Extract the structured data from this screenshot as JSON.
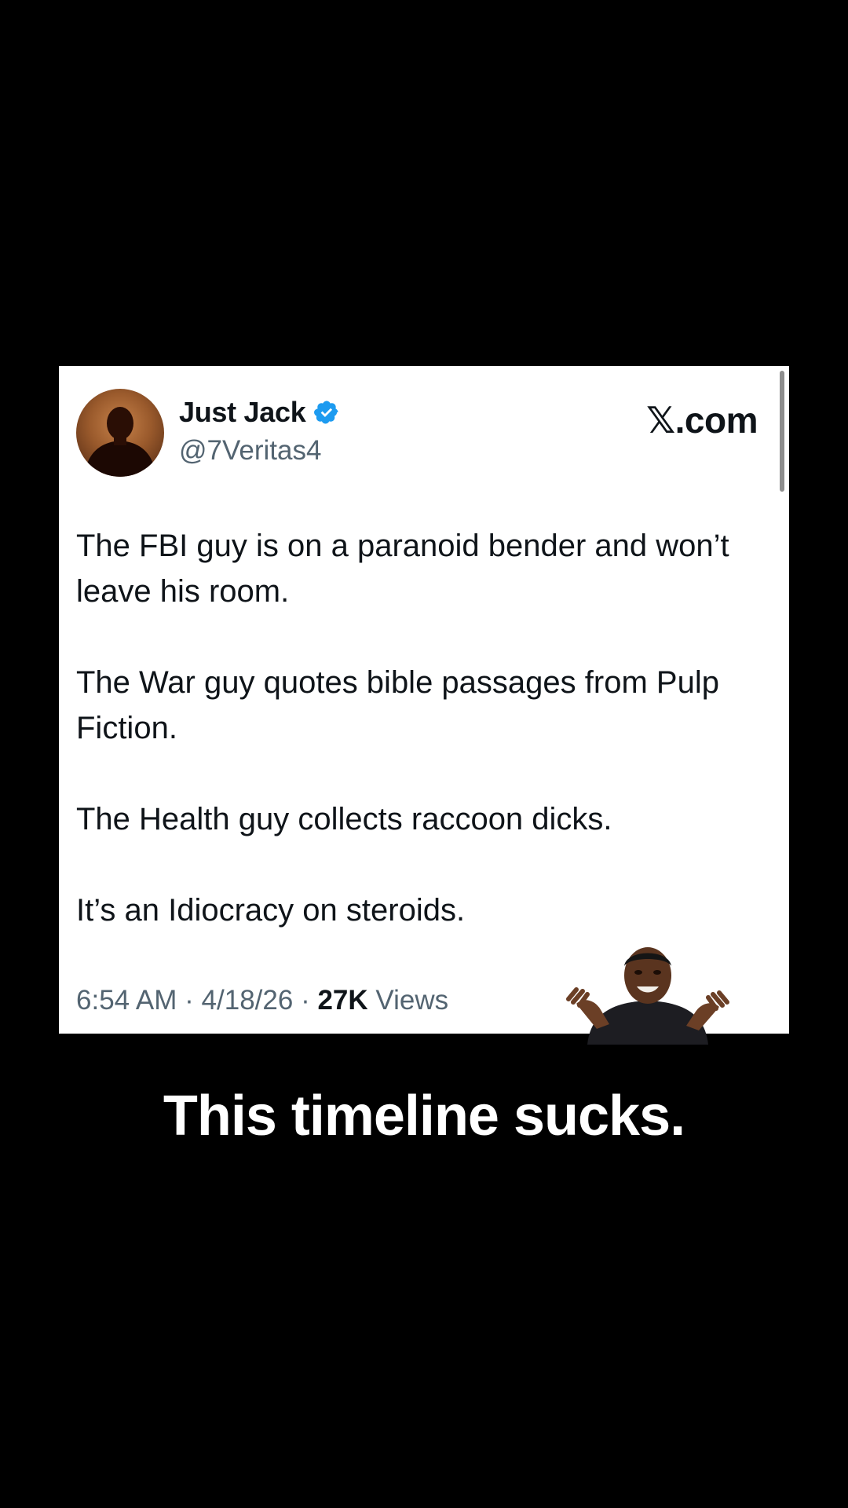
{
  "tweet": {
    "display_name": "Just Jack",
    "handle": "@7Veritas4",
    "brand": "𝕏.com",
    "paragraphs": [
      "The FBI guy is on a paranoid bender and won’t leave his room.",
      "The War guy quotes bible passages from Pulp Fiction.",
      "The Health guy collects raccoon dicks.",
      "It’s an Idiocracy on steroids."
    ],
    "time": "6:54 AM",
    "date": "4/18/26",
    "separator": "·",
    "views_count": "27K",
    "views_label": "Views"
  },
  "caption": "This timeline sucks.",
  "icons": {
    "verified": "verified-badge-icon",
    "avatar": "silhouette-avatar",
    "sticker": "shrugging-man-sticker"
  },
  "colors": {
    "background": "#000000",
    "card": "#ffffff",
    "text_primary": "#0f1419",
    "text_secondary": "#536471",
    "verified_blue": "#1d9bf0",
    "caption": "#ffffff"
  }
}
